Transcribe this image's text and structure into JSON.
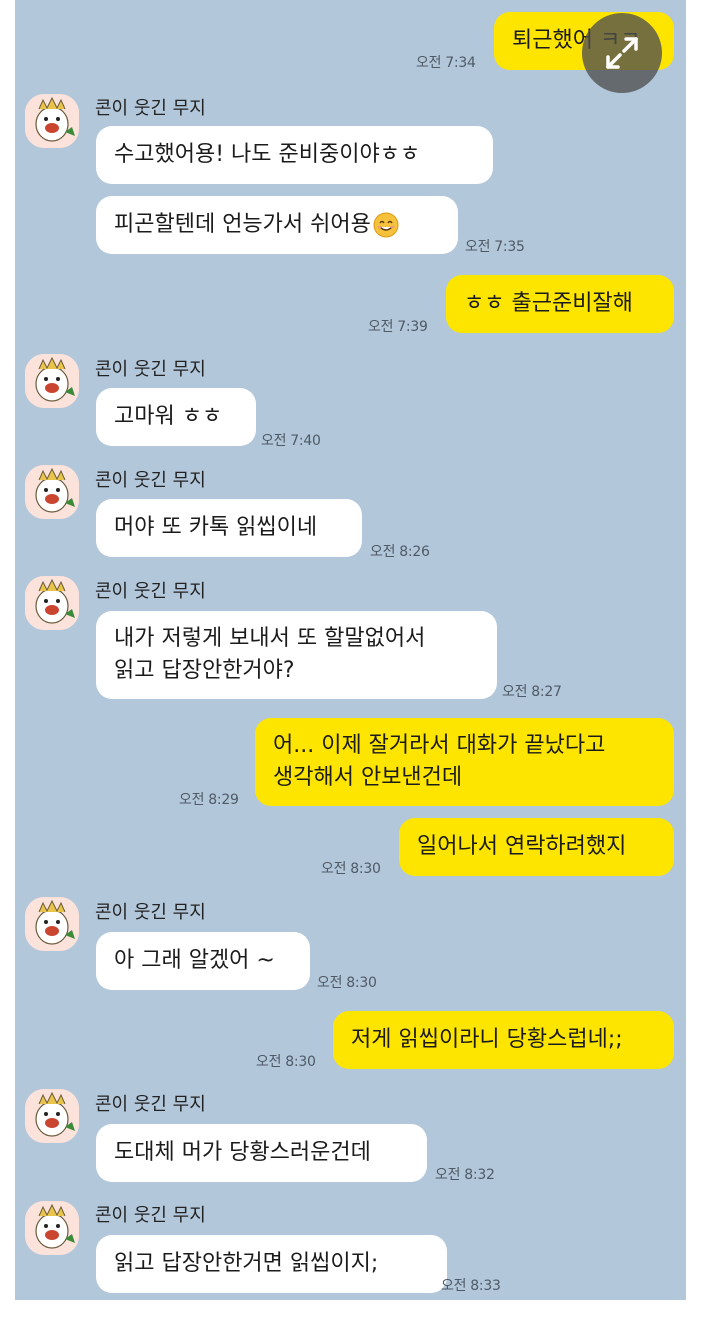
{
  "sender_name": "콘이 웃긴 무지",
  "messages": [
    {
      "side": "out",
      "lines": [
        "퇴근했어 ㅋㅋ"
      ],
      "time": "오전 7:34"
    },
    {
      "side": "in",
      "lines": [
        "수고했어용! 나도 준비중이야ㅎㅎ"
      ],
      "time": ""
    },
    {
      "side": "in",
      "lines": [
        "피곤할텐데 언능가서 쉬어용"
      ],
      "time": "오전 7:35"
    },
    {
      "side": "out",
      "lines": [
        "ㅎㅎ 출근준비잘해"
      ],
      "time": "오전 7:39"
    },
    {
      "side": "in",
      "lines": [
        "고마워 ㅎㅎ"
      ],
      "time": "오전 7:40"
    },
    {
      "side": "in",
      "lines": [
        "머야 또 카톡 읽씹이네"
      ],
      "time": "오전 8:26"
    },
    {
      "side": "in",
      "lines": [
        "내가 저렇게 보내서 또 할말없어서",
        "읽고 답장안한거야?"
      ],
      "time": "오전 8:27"
    },
    {
      "side": "out",
      "lines": [
        "어... 이제 잘거라서 대화가 끝났다고",
        "생각해서 안보낸건데"
      ],
      "time": "오전 8:29"
    },
    {
      "side": "out",
      "lines": [
        "일어나서 연락하려했지"
      ],
      "time": "오전 8:30"
    },
    {
      "side": "in",
      "lines": [
        "아 그래 알겠어 ~"
      ],
      "time": "오전 8:30"
    },
    {
      "side": "out",
      "lines": [
        "저게 읽씹이라니 당황스럽네;;"
      ],
      "time": "오전 8:30"
    },
    {
      "side": "in",
      "lines": [
        "도대체 머가 당황스러운건데"
      ],
      "time": "오전 8:32"
    },
    {
      "side": "in",
      "lines": [
        "읽고 답장안한거면 읽씹이지;"
      ],
      "time": "오전 8:33"
    }
  ],
  "icons": {
    "avatar": "muzi-avatar-icon",
    "expand": "expand-arrows-icon",
    "emoji": "smiling-face-emoji-icon"
  },
  "colors": {
    "background": "#b2c7da",
    "outgoing_bubble": "#fee500",
    "incoming_bubble": "#ffffff"
  }
}
